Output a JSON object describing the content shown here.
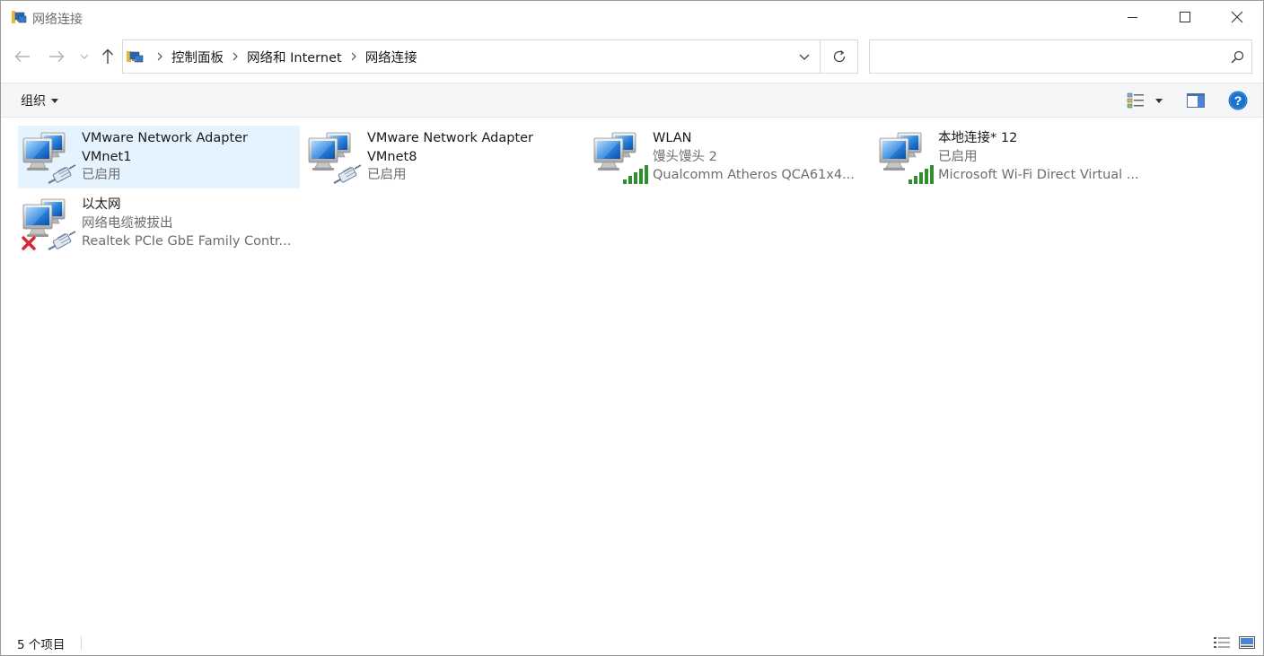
{
  "window": {
    "title": "网络连接"
  },
  "address": {
    "crumbs": [
      "控制面板",
      "网络和 Internet",
      "网络连接"
    ]
  },
  "search": {
    "placeholder": "",
    "value": ""
  },
  "toolbar": {
    "organize_label": "组织"
  },
  "items": [
    {
      "name_line1": "VMware Network Adapter",
      "name_line2": "VMnet1",
      "status": "已启用",
      "device": "",
      "icon": "wired-network-icon",
      "selected": true
    },
    {
      "name_line1": "VMware Network Adapter",
      "name_line2": "VMnet8",
      "status": "已启用",
      "device": "",
      "icon": "wired-network-icon",
      "selected": false
    },
    {
      "name_line1": "WLAN",
      "name_line2": "",
      "status": "馒头馒头 2",
      "device": "Qualcomm Atheros QCA61x4...",
      "icon": "wireless-network-icon",
      "selected": false
    },
    {
      "name_line1": "本地连接* 12",
      "name_line2": "",
      "status": "已启用",
      "device": "Microsoft Wi-Fi Direct Virtual ...",
      "icon": "wireless-network-icon",
      "selected": false
    },
    {
      "name_line1": "以太网",
      "name_line2": "",
      "status": "网络电缆被拔出",
      "device": "Realtek PCIe GbE Family Contr...",
      "icon": "disconnected-network-icon",
      "selected": false
    }
  ],
  "statusbar": {
    "count_text": "5 个项目"
  },
  "colors": {
    "selection": "#e5f3ff",
    "help_blue": "#1a73c8",
    "monitor_blue": "#2a7fd4",
    "signal_green": "#3a9a3a",
    "error_red": "#d8262e"
  }
}
